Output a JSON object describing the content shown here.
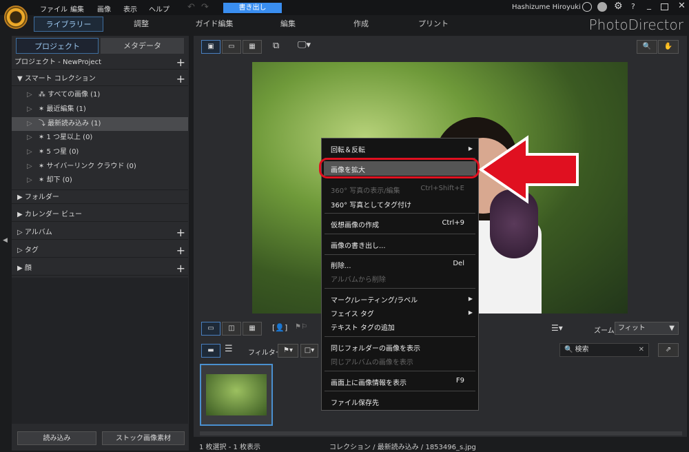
{
  "menubar": {
    "items": [
      "ファイル",
      "編集",
      "画像",
      "表示",
      "ヘルプ"
    ],
    "export": "書き出し",
    "user": "Hashizume Hiroyuki",
    "help": "?"
  },
  "nav": {
    "tabs": [
      "ライブラリー",
      "調整",
      "ガイド編集",
      "編集",
      "作成",
      "プリント"
    ],
    "brand": "PhotoDirector"
  },
  "left": {
    "tabs": [
      "プロジェクト",
      "メタデータ"
    ],
    "project": "プロジェクト - NewProject",
    "smart": "スマート コレクション",
    "smart_items": [
      "すべての画像 (1)",
      "最近編集 (1)",
      "最新読み込み (1)",
      "1 つ星以上 (0)",
      "5 つ星 (0)",
      "サイバーリンク クラウド (0)",
      "却下 (0)"
    ],
    "sections": [
      "フォルダー",
      "カレンダー ビュー",
      "アルバム",
      "タグ",
      "顔"
    ],
    "import": "読み込み",
    "stock": "ストック画像素材"
  },
  "toolbar": {
    "zoom_label": "ズーム:",
    "zoom_value": "フィット",
    "filter_label": "フィルター:",
    "search_placeholder": "検索"
  },
  "context_menu": [
    {
      "label": "回転＆反転",
      "submenu": true
    },
    {
      "label": "画像を拡大",
      "highlighted": true
    },
    {
      "label": "360° 写真の表示/編集",
      "shortcut": "Ctrl+Shift+E",
      "disabled": true
    },
    {
      "label": "360° 写真としてタグ付け"
    },
    {
      "label": "仮想画像の作成",
      "shortcut": "Ctrl+9"
    },
    {
      "label": "画像の書き出し..."
    },
    {
      "label": "削除...",
      "shortcut": "Del"
    },
    {
      "label": "アルバムから削除",
      "disabled": true
    },
    {
      "label": "マーク/レーティング/ラベル",
      "submenu": true
    },
    {
      "label": "フェイス タグ",
      "submenu": true
    },
    {
      "label": "テキスト タグの追加"
    },
    {
      "label": "同じフォルダーの画像を表示"
    },
    {
      "label": "同じアルバムの画像を表示",
      "disabled": true
    },
    {
      "label": "画面上に画像情報を表示",
      "shortcut": "F9"
    },
    {
      "label": "ファイル保存先"
    }
  ],
  "status": {
    "selection": "1 枚選択 - 1 枚表示",
    "path": "コレクション / 最新読み込み / 1853496_s.jpg"
  },
  "colors": {
    "accent": "#3a8ef0",
    "annotation": "#e01020"
  }
}
